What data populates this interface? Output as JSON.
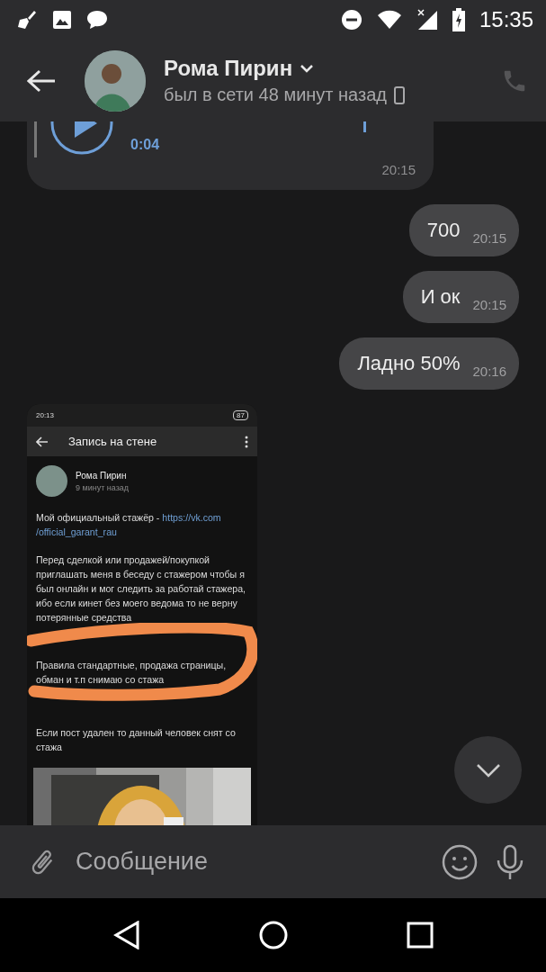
{
  "status_bar": {
    "time": "15:35"
  },
  "header": {
    "name": "Рома Пирин",
    "status": "был в сети 48 минут назад"
  },
  "messages": [
    {
      "kind": "voice",
      "duration": "0:04",
      "time": "20:15"
    },
    {
      "kind": "text",
      "text": "700",
      "time": "20:15"
    },
    {
      "kind": "text",
      "text": "И ок",
      "time": "20:15"
    },
    {
      "kind": "text",
      "text": "Ладно 50%",
      "time": "20:16"
    },
    {
      "kind": "screenshot",
      "screenshot": {
        "time": "20:13",
        "battery": "87",
        "title": "Запись на стене",
        "author": "Рома Пирин",
        "posted": "9 минут назад",
        "intro": "Мой официальный стажёр - ",
        "link_lines": [
          "https://vk.com",
          "/official_garant_rau"
        ],
        "paragraphs": [
          "Перед сделкой или продажей/покупкой приглашать меня в беседу с стажером чтобы я был онлайн и мог следить за работай стажера, ибо если кинет без моего ведома то не верну потерянные средства",
          "Правила стандартные, продажа страницы, обман и т.п снимаю со стажа",
          "Если пост удален то данный человек снят со стажа"
        ]
      }
    }
  ],
  "composer": {
    "placeholder": "Сообщение"
  }
}
